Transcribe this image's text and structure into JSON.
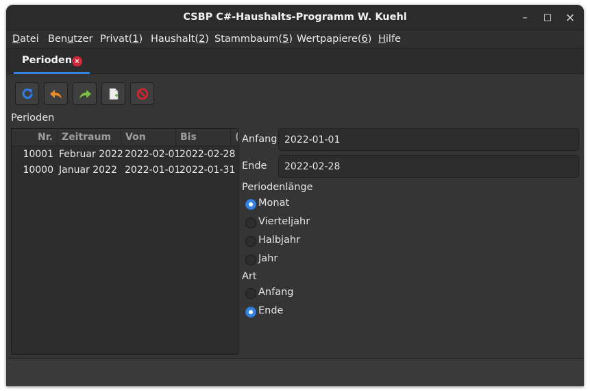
{
  "window": {
    "title": "CSBP C#-Haushalts-Programm W. Kuehl",
    "minimize": "–",
    "maximize": "□",
    "close": "×"
  },
  "menu": [
    {
      "label": "Datei"
    },
    {
      "label": "Benutzer"
    },
    {
      "label": "Privat(1)"
    },
    {
      "label": "Haushalt(2)"
    },
    {
      "label": "Stammbaum(5)"
    },
    {
      "label": "Wertpapiere(6)"
    },
    {
      "label": "Hilfe"
    }
  ],
  "tab": {
    "label": "Perioden",
    "close": "×"
  },
  "toolbar": [
    {
      "name": "refresh",
      "icon": "refresh-icon",
      "color": "#2f7de1"
    },
    {
      "name": "undo",
      "icon": "undo-icon",
      "color": "#f08a24"
    },
    {
      "name": "redo",
      "icon": "redo-icon",
      "color": "#7cc142"
    },
    {
      "name": "new",
      "icon": "new-document-icon",
      "color": "#e8e8e8"
    },
    {
      "name": "delete",
      "icon": "delete-icon",
      "color": "#d8222d"
    }
  ],
  "list_label": "Perioden",
  "table": {
    "columns": [
      "Nr.",
      "Zeitraum",
      "Von",
      "Bis",
      "("
    ],
    "rows": [
      {
        "nr": "10001",
        "zeitraum": "Februar 2022",
        "von": "2022-02-01",
        "bis": "2022-02-28"
      },
      {
        "nr": "10000",
        "zeitraum": "Januar 2022",
        "von": "2022-01-01",
        "bis": "2022-01-31"
      }
    ]
  },
  "form": {
    "anfang_label": "Anfang",
    "anfang_value": "2022-01-01",
    "ende_label": "Ende",
    "ende_value": "2022-02-28",
    "length_label": "Periodenlänge",
    "length_options": [
      {
        "label": "Monat",
        "checked": true
      },
      {
        "label": "Vierteljahr",
        "checked": false
      },
      {
        "label": "Halbjahr",
        "checked": false
      },
      {
        "label": "Jahr",
        "checked": false
      }
    ],
    "art_label": "Art",
    "art_options": [
      {
        "label": "Anfang",
        "checked": false
      },
      {
        "label": "Ende",
        "checked": true
      }
    ]
  },
  "colors": {
    "accent": "#3584e4",
    "tab_close": "#d0283a"
  }
}
